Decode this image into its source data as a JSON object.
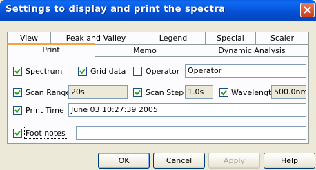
{
  "window": {
    "title": "Settings to display and print the spectra"
  },
  "tabs": {
    "back_row": [
      "View",
      "Peak and Valley",
      "Legend",
      "Special",
      "Scaler"
    ],
    "front_row": [
      "Print",
      "Memo",
      "Dynamic Analysis"
    ],
    "active": "Print"
  },
  "print_tab": {
    "spectrum": {
      "label": "Spectrum",
      "checked": true
    },
    "grid_data": {
      "label": "Grid data",
      "checked": true
    },
    "operator": {
      "label": "Operator",
      "checked": false,
      "value": "Operator"
    },
    "scan_range": {
      "label": "Scan Range",
      "checked": true,
      "value": "20s"
    },
    "scan_step": {
      "label": "Scan Step",
      "checked": true,
      "value": "1.0s"
    },
    "wavelength": {
      "label": "Wavelength",
      "checked": true,
      "value": "500.0nm"
    },
    "print_time": {
      "label": "Print Time",
      "checked": true,
      "value": "June 03 10:27:39 2005"
    },
    "foot_notes": {
      "label": "Foot notes",
      "checked": true,
      "value": ""
    }
  },
  "buttons": {
    "ok": "OK",
    "cancel": "Cancel",
    "apply": "Apply",
    "help": "Help"
  },
  "colors": {
    "titlebar": "#0552d6",
    "face": "#ece9d8",
    "active_tab_accent": "#f5a33a"
  }
}
